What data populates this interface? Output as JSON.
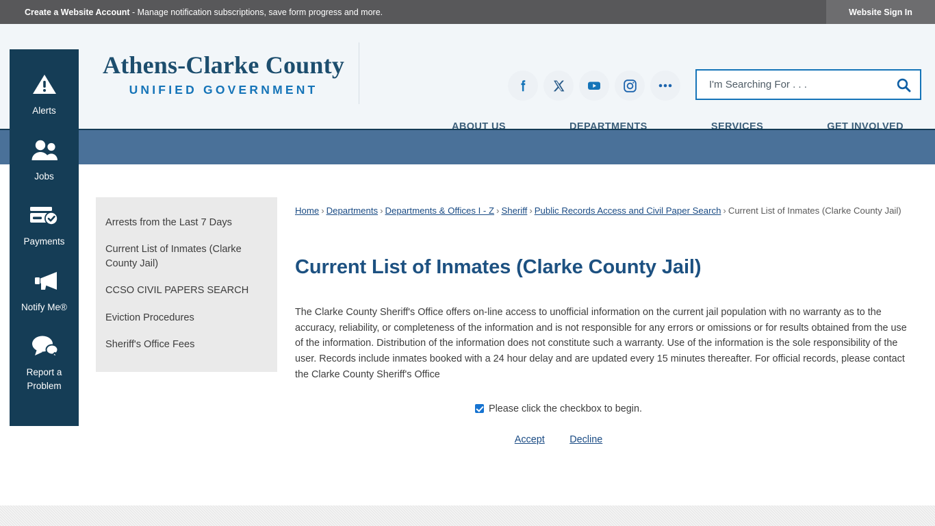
{
  "topbar": {
    "account_strong": "Create a Website Account",
    "account_rest": " - Manage notification subscriptions, save form progress and more.",
    "signin_label": "Website Sign In"
  },
  "header": {
    "logo_line1": "Athens-Clarke County",
    "logo_line2": "UNIFIED GOVERNMENT",
    "social": [
      {
        "name": "facebook",
        "label": "Facebook"
      },
      {
        "name": "x-twitter",
        "label": "X"
      },
      {
        "name": "youtube",
        "label": "YouTube"
      },
      {
        "name": "instagram",
        "label": "Instagram"
      },
      {
        "name": "more",
        "label": "More"
      }
    ],
    "search": {
      "placeholder": "I'm Searching For . . .",
      "value": "",
      "button_label": "Search"
    },
    "nav": [
      {
        "label": "About Us"
      },
      {
        "label": "Departments"
      },
      {
        "label": "Services"
      },
      {
        "label": "Get Involved"
      }
    ]
  },
  "rail": {
    "items": [
      {
        "icon": "alert-triangle-icon",
        "label": "Alerts"
      },
      {
        "icon": "people-icon",
        "label": "Jobs"
      },
      {
        "icon": "credit-card-check-icon",
        "label": "Payments"
      },
      {
        "icon": "megaphone-icon",
        "label": "Notify Me®"
      },
      {
        "icon": "speech-bubbles-icon",
        "label": "Report a Problem"
      }
    ]
  },
  "content_sidebar": {
    "links": [
      {
        "label": "Arrests from the Last 7 Days"
      },
      {
        "label": "Current List of Inmates (Clarke County Jail)"
      },
      {
        "label": "CCSO CIVIL PAPERS SEARCH"
      },
      {
        "label": "Eviction Procedures"
      },
      {
        "label": "Sheriff's Office Fees"
      }
    ]
  },
  "main": {
    "breadcrumb": {
      "links": [
        {
          "label": "Home"
        },
        {
          "label": "Departments"
        },
        {
          "label": "Departments & Offices I - Z"
        },
        {
          "label": "Sheriff"
        },
        {
          "label": "Public Records Access and Civil Paper Search"
        }
      ],
      "current": "Current List of Inmates (Clarke County Jail)",
      "separator": "›"
    },
    "title": "Current List of Inmates (Clarke County Jail)",
    "paragraph": "The Clarke County Sheriff's Office offers on-line access to unofficial information on the current jail population with no warranty as to the accuracy, reliability, or completeness of the information and is not responsible for any errors or omissions or for results obtained from the use of the information. Distribution of the information does not constitute such a warranty. Use of the information is the sole responsibility of the user. Records include inmates booked with a 24 hour delay and are updated every 15 minutes thereafter. For official records, please contact the Clarke County Sheriff's Office",
    "consent_label": "Please click the checkbox to begin.",
    "consent_checked": true,
    "accept_label": "Accept",
    "decline_label": "Decline"
  },
  "colors": {
    "brand_navy": "#153d56",
    "brand_blue": "#1574b8",
    "band_blue": "#4a7199",
    "link_blue": "#1a4b84",
    "topbar_gray": "#58585a"
  }
}
